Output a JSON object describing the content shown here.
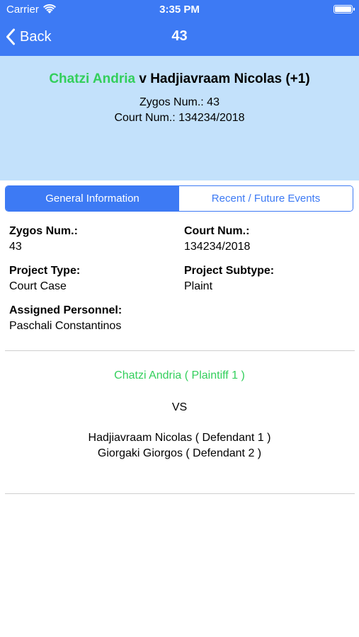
{
  "status_bar": {
    "carrier": "Carrier",
    "time": "3:35 PM"
  },
  "nav": {
    "back_label": "Back",
    "title": "43"
  },
  "header": {
    "plaintiff_name": "Chatzi Andria",
    "versus_text": " v Hadjiavraam Nicolas (+1)",
    "zygos_line": "Zygos Num.: 43",
    "court_line": "Court Num.: 134234/2018"
  },
  "tabs": [
    {
      "label": "General Information",
      "active": true
    },
    {
      "label": "Recent / Future Events",
      "active": false
    }
  ],
  "details": {
    "zygos": {
      "label": "Zygos Num.:",
      "value": "43"
    },
    "court": {
      "label": "Court Num.:",
      "value": "134234/2018"
    },
    "project_type": {
      "label": "Project Type:",
      "value": "Court Case"
    },
    "project_subtype": {
      "label": "Project Subtype:",
      "value": "Plaint"
    },
    "personnel": {
      "label": "Assigned Personnel:",
      "value": "Paschali Constantinos"
    }
  },
  "parties": {
    "plaintiff": "Chatzi Andria ( Plaintiff 1 )",
    "vs": "VS",
    "defendants": [
      "Hadjiavraam Nicolas ( Defendant 1 )",
      "Giorgaki Giorgos ( Defendant 2 )"
    ]
  },
  "colors": {
    "accent": "#3d7af4",
    "header_bg": "#c3e1fb",
    "plaintiff_green": "#33cf5c"
  },
  "icons": {
    "wifi": "wifi-icon",
    "battery": "battery-icon",
    "back": "chevron-left-icon"
  }
}
